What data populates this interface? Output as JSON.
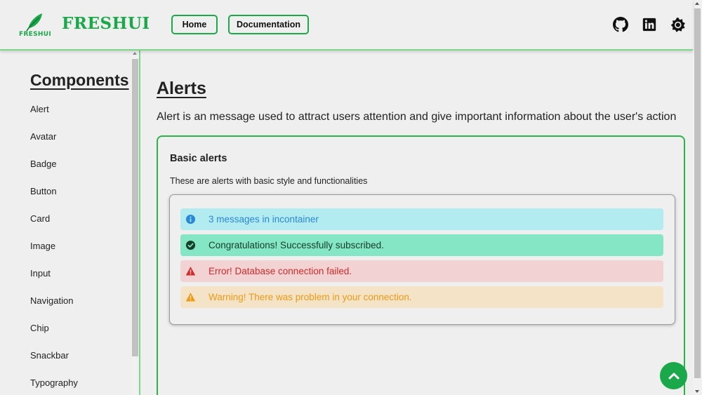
{
  "header": {
    "logo_small_text": "FRESHUI",
    "brand": "FRESHUI",
    "nav": [
      {
        "label": "Home"
      },
      {
        "label": "Documentation"
      }
    ],
    "icons": [
      "github-icon",
      "linkedin-icon",
      "theme-toggle-icon"
    ]
  },
  "sidebar": {
    "title": "Components",
    "items": [
      {
        "label": "Alert"
      },
      {
        "label": "Avatar"
      },
      {
        "label": "Badge"
      },
      {
        "label": "Button"
      },
      {
        "label": "Card"
      },
      {
        "label": "Image"
      },
      {
        "label": "Input"
      },
      {
        "label": "Navigation"
      },
      {
        "label": "Chip"
      },
      {
        "label": "Snackbar"
      },
      {
        "label": "Typography"
      }
    ]
  },
  "main": {
    "title": "Alerts",
    "description": "Alert is an message used to attract users attention and give important information about the user's action",
    "section": {
      "title": "Basic alerts",
      "description": "These are alerts with basic style and functionalities",
      "alerts": [
        {
          "type": "info",
          "icon": "info-icon",
          "text": "3 messages in incontainer"
        },
        {
          "type": "success",
          "icon": "check-circle-icon",
          "text": "Congratulations! Successfully subscribed."
        },
        {
          "type": "error",
          "icon": "warning-triangle-icon",
          "text": "Error! Database connection failed."
        },
        {
          "type": "warning",
          "icon": "warning-triangle-icon",
          "text": "Warning! There was problem in your connection."
        }
      ]
    }
  },
  "colors": {
    "brand_green": "#1aa84a",
    "info_bg": "#b2ebf0",
    "success_bg": "#84e6c4",
    "error_bg": "#f2d2d3",
    "warning_bg": "#f5e3c8"
  },
  "fab": {
    "icon": "chevron-up-icon"
  }
}
